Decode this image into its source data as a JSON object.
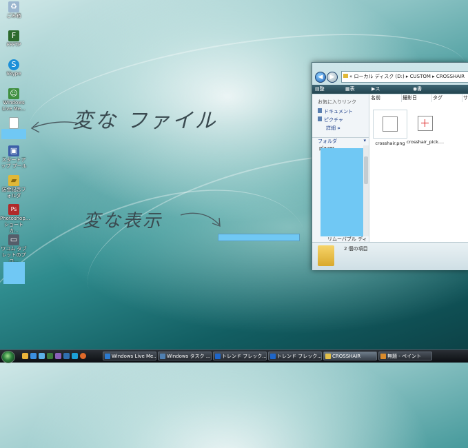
{
  "desktop": {
    "icons": [
      {
        "label": "ごみ箱",
        "glyph": "♻",
        "color": "#9bb6cf"
      },
      {
        "label": "FFFTP",
        "glyph": "F",
        "color": "#2d6a2d"
      },
      {
        "label": "Skype",
        "glyph": "S",
        "color": "#1b8fd8"
      },
      {
        "label": "Windows Live Me...",
        "glyph": "☺",
        "color": "#3f8f3f"
      },
      {
        "label": "",
        "glyph": "",
        "color": "#ffffff"
      },
      {
        "label": "スタートアップ プール",
        "glyph": "▣",
        "color": "#3d5fa8"
      },
      {
        "label": "送金記念フォルダ",
        "glyph": "▰",
        "color": "#e0b838"
      },
      {
        "label": "Photoshop... ショートカ...",
        "glyph": "Ps",
        "color": "#b02a2a"
      },
      {
        "label": "ワコム タブレットのプロ...",
        "glyph": "▭",
        "color": "#555e6a"
      }
    ],
    "annotations": {
      "note1": "変な ファイル",
      "note2": "変な表示"
    }
  },
  "explorer": {
    "breadcrumb": "« ローカル ディスク (D:) ▸ CUSTOM ▸ CROSSHAIR",
    "toolbar": {
      "organize": "整理 ▾",
      "view": "表示 ▾",
      "slideshow": "スライドショー",
      "burn": "書き込む"
    },
    "favorites_title": "お気に入りリンク",
    "links": [
      {
        "label": "ドキュメント"
      },
      {
        "label": "ピクチャ"
      }
    ],
    "more": "詳細",
    "folder_title": "フォルダ",
    "folder_item": "player",
    "removable": "リムーバブル ディ",
    "columns": [
      "名前",
      "撮影日",
      "タグ",
      "サ"
    ],
    "files": [
      {
        "name": "crosshair.png"
      },
      {
        "name": "crosshair_pick...."
      }
    ],
    "status": "2 個の項目"
  },
  "taskbar": {
    "buttons": [
      {
        "label": "Windows Live Me...",
        "color": "#2c7bd0"
      },
      {
        "label": "Windows タスク ...",
        "color": "#4f7fb0"
      },
      {
        "label": "トレンド フレック...",
        "color": "#1e66c9"
      },
      {
        "label": "トレンド フレック...",
        "color": "#1e66c9"
      },
      {
        "label": "CROSSHAIR",
        "color": "#e3c04a"
      },
      {
        "label": "無題 - ペイント",
        "color": "#d98b2c"
      }
    ]
  }
}
